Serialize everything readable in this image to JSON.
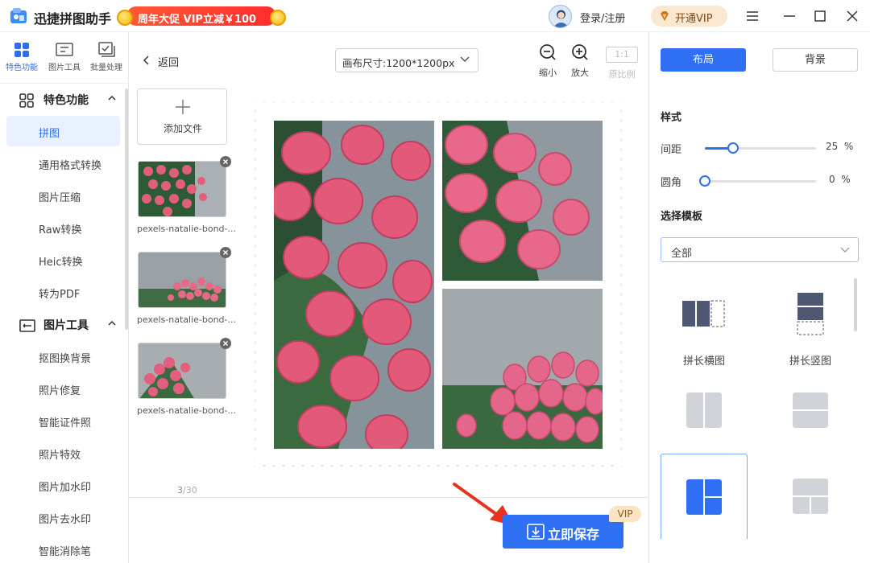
{
  "titlebar": {
    "app_title": "迅捷拼图助手",
    "promo_text": "周年大促 VIP立减￥100",
    "login_label": "登录/注册",
    "vip_button": "开通VIP"
  },
  "topnav": [
    {
      "label": "特色功能",
      "icon": "grid-icon",
      "active": true
    },
    {
      "label": "图片工具",
      "icon": "image-tool-icon",
      "active": false
    },
    {
      "label": "批量处理",
      "icon": "batch-icon",
      "active": false
    }
  ],
  "sidebar": {
    "group1": {
      "label": "特色功能"
    },
    "group1_items": [
      {
        "label": "拼图",
        "active": true
      },
      {
        "label": "通用格式转换"
      },
      {
        "label": "图片压缩"
      },
      {
        "label": "Raw转换"
      },
      {
        "label": "Heic转换"
      },
      {
        "label": "转为PDF"
      }
    ],
    "group2": {
      "label": "图片工具"
    },
    "group2_items": [
      {
        "label": "抠图换背景"
      },
      {
        "label": "照片修复"
      },
      {
        "label": "智能证件照"
      },
      {
        "label": "照片特效"
      },
      {
        "label": "图片加水印"
      },
      {
        "label": "图片去水印"
      },
      {
        "label": "智能消除笔"
      }
    ]
  },
  "editor": {
    "back_label": "返回",
    "canvas_size": "画布尺寸:1200*1200px",
    "zoom_out_label": "缩小",
    "zoom_in_label": "放大",
    "ratio_box": "1:1",
    "ratio_label": "原比例",
    "add_file_label": "添加文件",
    "files": [
      {
        "name": "pexels-natalie-bond-..."
      },
      {
        "name": "pexels-natalie-bond-..."
      },
      {
        "name": "pexels-natalie-bond-..."
      }
    ],
    "page_current": "3",
    "page_total": "/30",
    "save_label": "立即保存",
    "vip_tag": "VIP"
  },
  "right_panel": {
    "tab_layout": "布局",
    "tab_background": "背景",
    "style_title": "样式",
    "spacing_label": "间距",
    "spacing_value": "25",
    "spacing_percent": 25,
    "corner_label": "圆角",
    "corner_value": "0",
    "corner_percent": 0,
    "percent_unit": "%",
    "template_title": "选择模板",
    "template_filter": "全部",
    "templates": [
      {
        "label": "拼长横图"
      },
      {
        "label": "拼长竖图"
      }
    ]
  },
  "colors": {
    "accent": "#2f6ff3",
    "promo": "#ff3b2f",
    "vip": "#fbe6cf"
  }
}
